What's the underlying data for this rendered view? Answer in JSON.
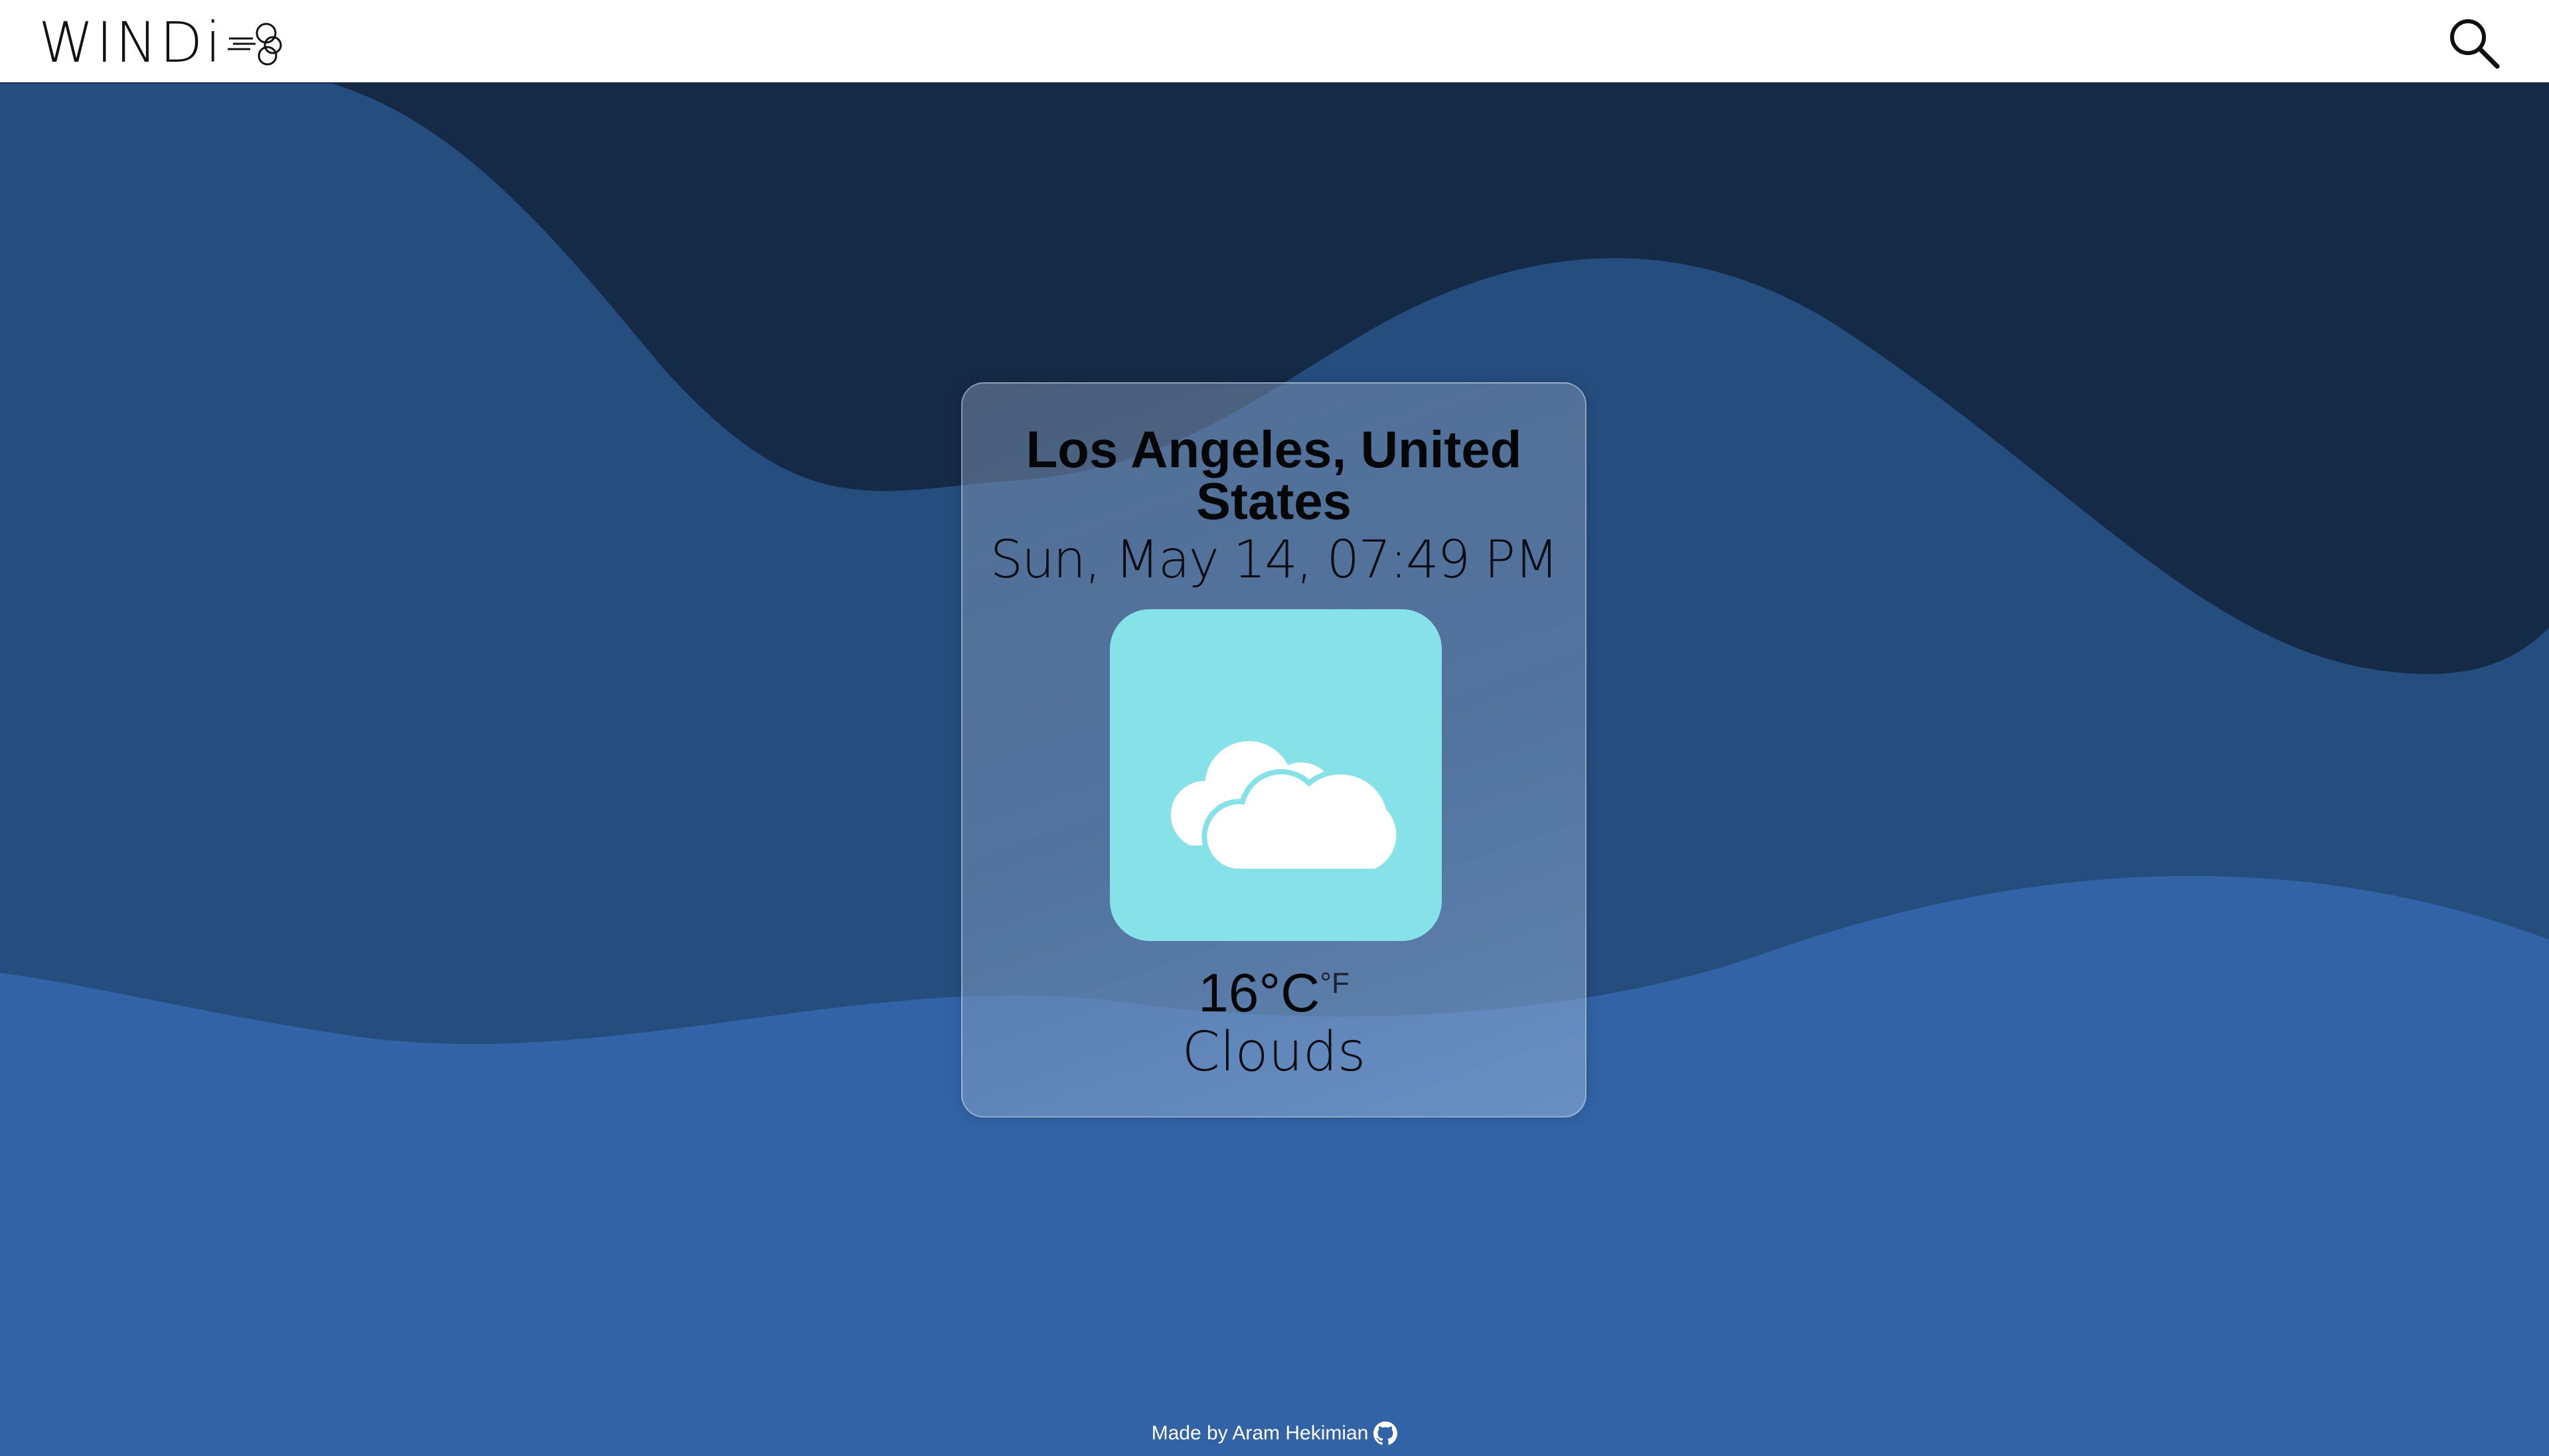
{
  "header": {
    "logo_text": "WINDi",
    "search_icon": "search-icon"
  },
  "colors": {
    "header_bg": "#ffffff",
    "wave_dark": "#152a47",
    "wave_mid": "#254d7e",
    "wave_light": "#3263a6",
    "icon_bg": "#87e1e8"
  },
  "weather": {
    "location": "Los Angeles, United States",
    "datetime": "Sun, May 14, 07:49 PM",
    "icon": "clouds-icon",
    "temperature": "16°C",
    "alt_unit": "°F",
    "condition": "Clouds"
  },
  "footer": {
    "text": "Made by Aram Hekimian",
    "icon": "github-icon"
  }
}
